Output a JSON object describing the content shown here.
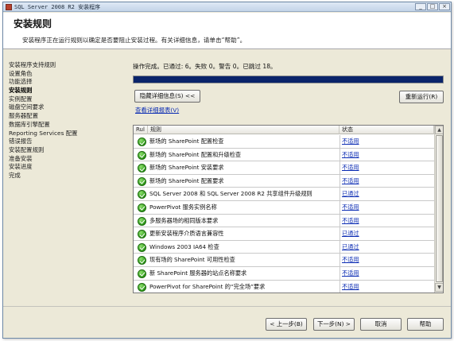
{
  "window": {
    "title": "SQL Server 2008 R2 安装程序",
    "controls": [
      "minimize",
      "maximize",
      "close"
    ]
  },
  "header": {
    "title": "安装规则",
    "description": "安装程序正在运行规则以确定是否要阻止安装过程。有关详细信息，请单击“帮助”。"
  },
  "nav": {
    "items": [
      {
        "label": "安装程序支持规则",
        "active": false
      },
      {
        "label": "设置角色",
        "active": false
      },
      {
        "label": "功能选择",
        "active": false
      },
      {
        "label": "安装规则",
        "active": true
      },
      {
        "label": "实例配置",
        "active": false
      },
      {
        "label": "磁盘空间要求",
        "active": false
      },
      {
        "label": "服务器配置",
        "active": false
      },
      {
        "label": "数据库引擎配置",
        "active": false
      },
      {
        "label": "Reporting Services 配置",
        "active": false
      },
      {
        "label": "错误报告",
        "active": false
      },
      {
        "label": "安装配置规则",
        "active": false
      },
      {
        "label": "准备安装",
        "active": false
      },
      {
        "label": "安装进度",
        "active": false
      },
      {
        "label": "完成",
        "active": false
      }
    ]
  },
  "main": {
    "status_text": "操作完成。已通过: 6。失败 0。警告 0。已跳过 18。",
    "progress_fraction": 1.0,
    "hide_details_label": "隐藏详细信息(S) <<",
    "rerun_label": "重新运行(R)",
    "view_report_link": "查看详细报表(V)",
    "table": {
      "columns": [
        "Rul",
        "规则",
        "状态"
      ],
      "rows": [
        {
          "rule": "新场的 SharePoint 配置检查",
          "status": "不适用"
        },
        {
          "rule": "新场的 SharePoint 配置和升级检查",
          "status": "不适用"
        },
        {
          "rule": "新场的 SharePoint 安装要求",
          "status": "不适用"
        },
        {
          "rule": "新场的 SharePoint 配置要求",
          "status": "不适用"
        },
        {
          "rule": "SQL Server 2008 和 SQL Server 2008 R2 共享组件升级规则",
          "status": "已通过"
        },
        {
          "rule": "PowerPivot 服务实例名称",
          "status": "不适用"
        },
        {
          "rule": "多服务器场的相同版本要求",
          "status": "不适用"
        },
        {
          "rule": "更新安装程序介质语言兼容性",
          "status": "已通过"
        },
        {
          "rule": "Windows 2003 IA64 检查",
          "status": "已通过"
        },
        {
          "rule": "现有场的 SharePoint 可用性检查",
          "status": "不适用"
        },
        {
          "rule": "新 SharePoint 服务器的站点名称要求",
          "status": "不适用"
        },
        {
          "rule": "PowerPivot for SharePoint 的“完全场”要求",
          "status": "不适用"
        }
      ]
    }
  },
  "footer": {
    "back_label": "< 上一步(B)",
    "next_label": "下一步(N) >",
    "cancel_label": "取消",
    "help_label": "帮助"
  },
  "colors": {
    "progress_fill": "#0a246a",
    "link": "#0a2bb3",
    "pass_icon": "#2f9a1a"
  }
}
